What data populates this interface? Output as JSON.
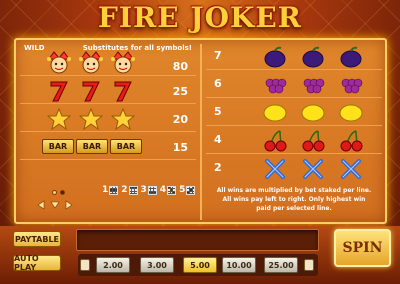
{
  "game": {
    "title": "FIRE JOKER"
  },
  "paytable": {
    "wild_label": "WILD",
    "wild_description": "Substitutes for all symbols!",
    "left_rows": [
      {
        "symbol": "joker-icon",
        "payout": "80"
      },
      {
        "symbol": "seven-icon",
        "payout": "25"
      },
      {
        "symbol": "star-icon",
        "payout": "20"
      },
      {
        "symbol": "bar-icon",
        "payout": "15",
        "bar_text": "BAR"
      }
    ],
    "right_rows": [
      {
        "symbol": "plum-icon",
        "payout": "7"
      },
      {
        "symbol": "grapes-icon",
        "payout": "6"
      },
      {
        "symbol": "lemon-icon",
        "payout": "5"
      },
      {
        "symbol": "cherry-icon",
        "payout": "4"
      },
      {
        "symbol": "x-icon",
        "payout": "2"
      }
    ],
    "rules_line1": "All wins are multiplied by bet staked per line.",
    "rules_line2": "All wins pay left to right. Only highest win",
    "rules_line3": "paid per selected line.",
    "lines": [
      "1",
      "2",
      "3",
      "4",
      "5"
    ]
  },
  "controls": {
    "paytable_label": "PAYTABLE",
    "autoplay_label": "AUTO PLAY",
    "spin_label": "SPIN",
    "bets": [
      "2.00",
      "3.00",
      "5.00",
      "10.00",
      "25.00"
    ],
    "selected_bet": "5.00"
  },
  "colors": {
    "accent_gold": "#ffd03a",
    "panel_orange": "#e0862b",
    "bg_red": "#a8380e"
  }
}
